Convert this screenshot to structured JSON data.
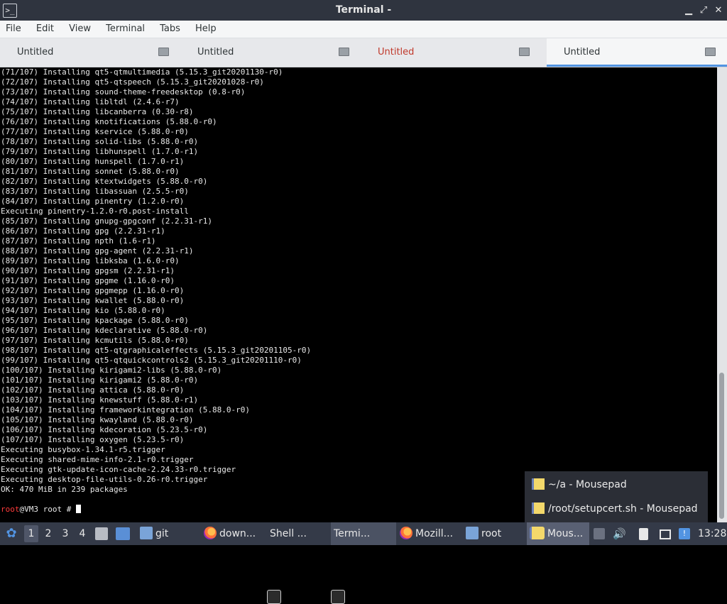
{
  "window": {
    "title": "Terminal -",
    "controls": {
      "minimize": "▁",
      "maximize": "⤢",
      "close": "✕"
    }
  },
  "menu": [
    "File",
    "Edit",
    "View",
    "Terminal",
    "Tabs",
    "Help"
  ],
  "tabs": [
    {
      "label": "Untitled",
      "state": "normal"
    },
    {
      "label": "Untitled",
      "state": "normal"
    },
    {
      "label": "Untitled",
      "state": "alert"
    },
    {
      "label": "Untitled",
      "state": "active"
    }
  ],
  "terminal": {
    "lines": [
      "(71/107) Installing qt5-qtmultimedia (5.15.3_git20201130-r0)",
      "(72/107) Installing qt5-qtspeech (5.15.3_git20201028-r0)",
      "(73/107) Installing sound-theme-freedesktop (0.8-r0)",
      "(74/107) Installing libltdl (2.4.6-r7)",
      "(75/107) Installing libcanberra (0.30-r8)",
      "(76/107) Installing knotifications (5.88.0-r0)",
      "(77/107) Installing kservice (5.88.0-r0)",
      "(78/107) Installing solid-libs (5.88.0-r0)",
      "(79/107) Installing libhunspell (1.7.0-r1)",
      "(80/107) Installing hunspell (1.7.0-r1)",
      "(81/107) Installing sonnet (5.88.0-r0)",
      "(82/107) Installing ktextwidgets (5.88.0-r0)",
      "(83/107) Installing libassuan (2.5.5-r0)",
      "(84/107) Installing pinentry (1.2.0-r0)",
      "Executing pinentry-1.2.0-r0.post-install",
      "(85/107) Installing gnupg-gpgconf (2.2.31-r1)",
      "(86/107) Installing gpg (2.2.31-r1)",
      "(87/107) Installing npth (1.6-r1)",
      "(88/107) Installing gpg-agent (2.2.31-r1)",
      "(89/107) Installing libksba (1.6.0-r0)",
      "(90/107) Installing gpgsm (2.2.31-r1)",
      "(91/107) Installing gpgme (1.16.0-r0)",
      "(92/107) Installing gpgmepp (1.16.0-r0)",
      "(93/107) Installing kwallet (5.88.0-r0)",
      "(94/107) Installing kio (5.88.0-r0)",
      "(95/107) Installing kpackage (5.88.0-r0)",
      "(96/107) Installing kdeclarative (5.88.0-r0)",
      "(97/107) Installing kcmutils (5.88.0-r0)",
      "(98/107) Installing qt5-qtgraphicaleffects (5.15.3_git20201105-r0)",
      "(99/107) Installing qt5-qtquickcontrols2 (5.15.3_git20201110-r0)",
      "(100/107) Installing kirigami2-libs (5.88.0-r0)",
      "(101/107) Installing kirigami2 (5.88.0-r0)",
      "(102/107) Installing attica (5.88.0-r0)",
      "(103/107) Installing knewstuff (5.88.0-r1)",
      "(104/107) Installing frameworkintegration (5.88.0-r0)",
      "(105/107) Installing kwayland (5.88.0-r0)",
      "(106/107) Installing kdecoration (5.23.5-r0)",
      "(107/107) Installing oxygen (5.23.5-r0)",
      "Executing busybox-1.34.1-r5.trigger",
      "Executing shared-mime-info-2.1-r0.trigger",
      "Executing gtk-update-icon-cache-2.24.33-r0.trigger",
      "Executing desktop-file-utils-0.26-r0.trigger",
      "OK: 470 MiB in 239 packages"
    ],
    "prompt": {
      "user": "root",
      "host": "@VM3 root # "
    }
  },
  "popup": {
    "items": [
      "~/a - Mousepad",
      "/root/setupcert.sh - Mousepad"
    ]
  },
  "taskbar": {
    "workspaces": [
      "1",
      "2",
      "3",
      "4"
    ],
    "launchers": [
      {
        "label": "git",
        "icon": "folder-icon"
      }
    ],
    "windows": [
      {
        "label": "down...",
        "icon": "firefox-icon"
      },
      {
        "label": "Shell ...",
        "icon": "terminal-icon"
      },
      {
        "label": "Termi...",
        "icon": "terminal-icon"
      },
      {
        "label": "Mozill...",
        "icon": "firefox-icon"
      },
      {
        "label": "root",
        "icon": "folder-icon"
      },
      {
        "label": "Mous...",
        "icon": "notepad-icon"
      }
    ],
    "clock": "13:28"
  },
  "colors": {
    "titlebar": "#2f343f",
    "accent": "#5294e2",
    "taskbar": "#343a48",
    "prompt_user": "#ff3b3b"
  }
}
